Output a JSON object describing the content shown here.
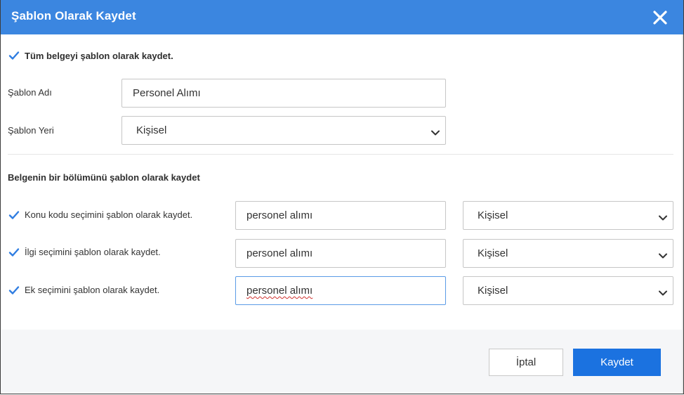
{
  "dialog": {
    "title": "Şablon Olarak Kaydet",
    "close_icon": "close-icon"
  },
  "whole_document": {
    "checked": true,
    "label": "Tüm belgeyi şablon olarak kaydet."
  },
  "template_name": {
    "label": "Şablon Adı",
    "value": "Personel Alımı"
  },
  "template_location": {
    "label": "Şablon Yeri",
    "value": "Kişisel"
  },
  "section": {
    "heading": "Belgenin bir bölümünü şablon olarak kaydet",
    "rows": [
      {
        "checked": true,
        "label": "Konu kodu seçimini şablon olarak kaydet.",
        "name_value": "personel alımı",
        "location_value": "Kişisel"
      },
      {
        "checked": true,
        "label": "İlgi seçimini şablon olarak kaydet.",
        "name_value": "personel alımı",
        "location_value": "Kişisel"
      },
      {
        "checked": true,
        "label": "Ek seçimini şablon olarak kaydet.",
        "name_value": "personel alımı",
        "location_value": "Kişisel"
      }
    ]
  },
  "footer": {
    "cancel_label": "İptal",
    "save_label": "Kaydet"
  },
  "colors": {
    "header": "#3b86e0",
    "primary_button": "#1b72e0",
    "checkbox": "#2f7de1"
  }
}
